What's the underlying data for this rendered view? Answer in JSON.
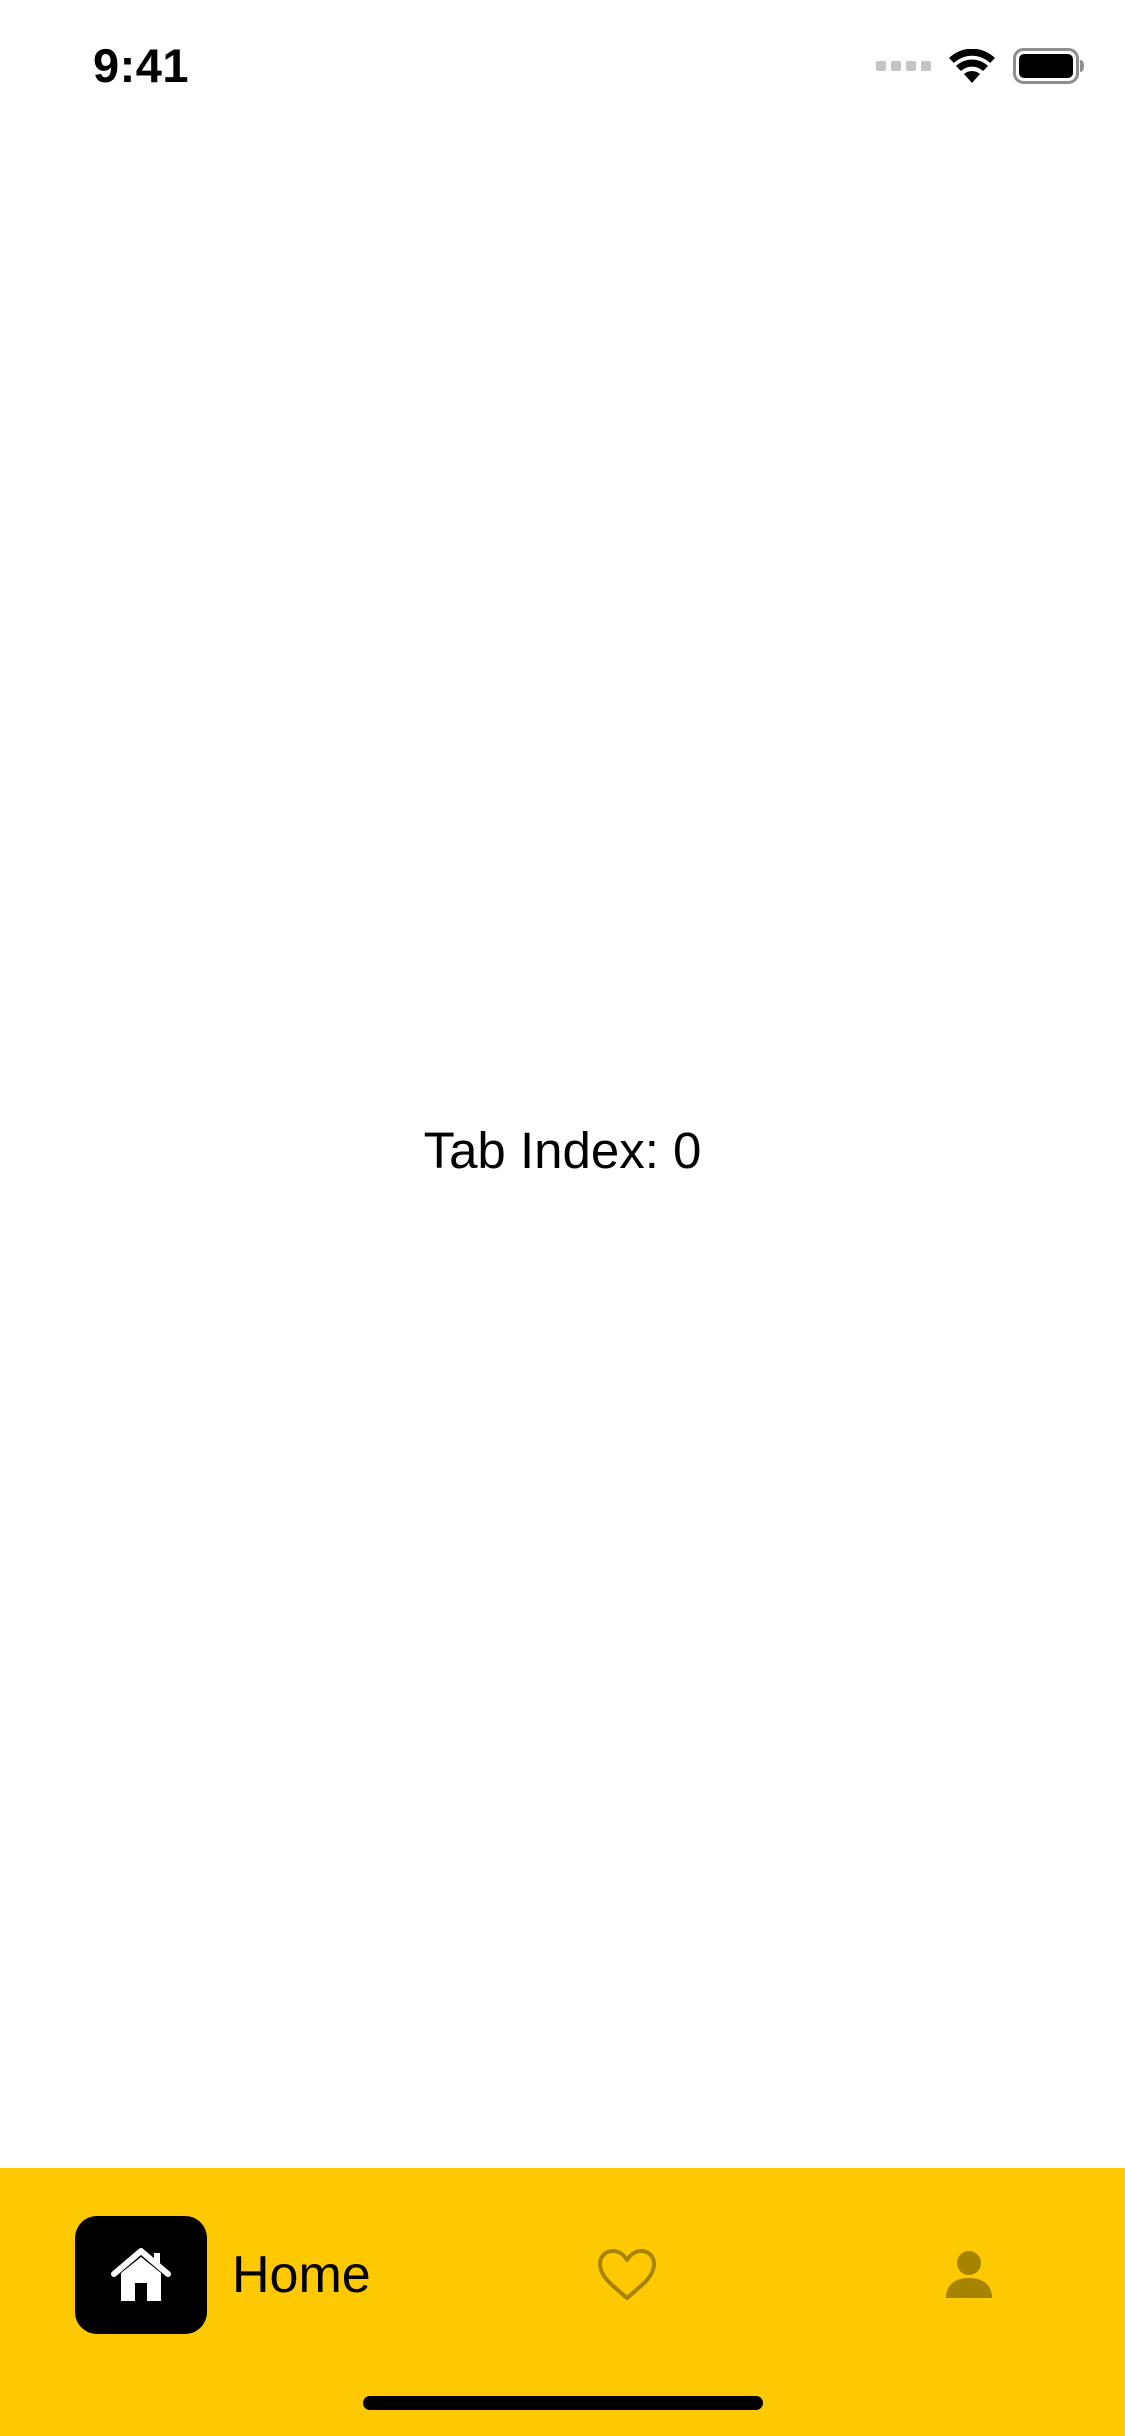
{
  "status_bar": {
    "time": "9:41",
    "icons": [
      "signal-icon",
      "wifi-icon",
      "battery-icon"
    ]
  },
  "main": {
    "tab_index_text": "Tab Index: 0"
  },
  "tab_bar": {
    "background_color": "#fec900",
    "active_tab_index": 0,
    "tabs": [
      {
        "label": "Home",
        "icon": "home-icon",
        "active": true
      },
      {
        "label": "",
        "icon": "heart-icon",
        "active": false
      },
      {
        "label": "",
        "icon": "person-icon",
        "active": false
      }
    ],
    "active_icon_bg": "#000000",
    "inactive_icon_color": "#a78400"
  }
}
